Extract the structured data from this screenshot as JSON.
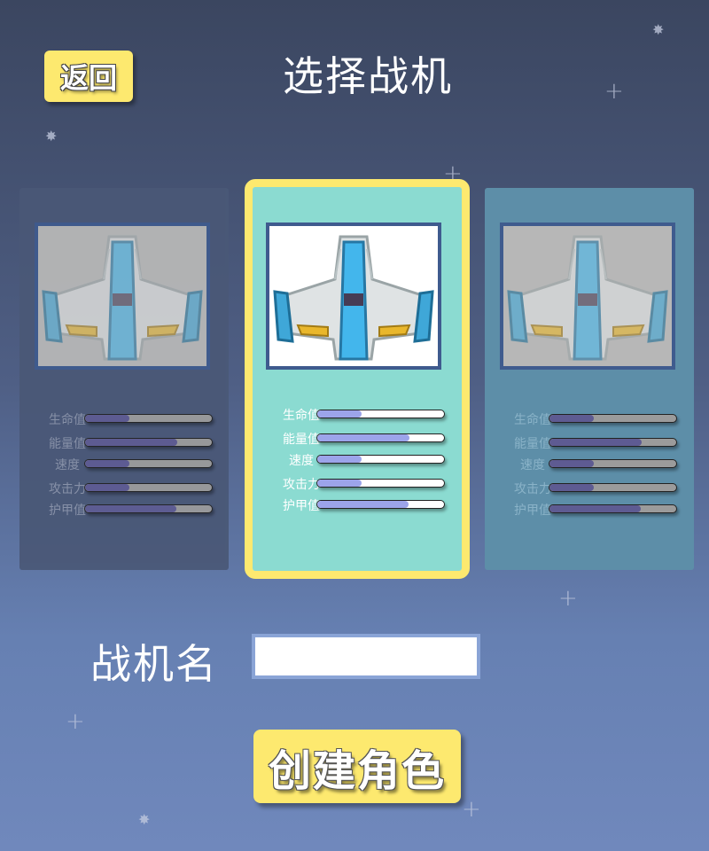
{
  "header": {
    "back_label": "返回",
    "title": "选择战机"
  },
  "stat_labels": [
    "生命值",
    "能量值",
    "速度",
    "攻击力",
    "护甲值"
  ],
  "cards": [
    {
      "id": "left",
      "selected": false,
      "stats": [
        0.35,
        0.73,
        0.35,
        0.35,
        0.72
      ]
    },
    {
      "id": "center",
      "selected": true,
      "stats": [
        0.35,
        0.73,
        0.35,
        0.35,
        0.72
      ]
    },
    {
      "id": "right",
      "selected": false,
      "stats": [
        0.35,
        0.73,
        0.35,
        0.35,
        0.72
      ]
    }
  ],
  "form": {
    "name_label": "战机名",
    "name_value": "",
    "create_label": "创建角色"
  },
  "colors": {
    "accent_yellow": "#fde96f",
    "selected_card": "#8bdbd1",
    "stat_fill": "#9ca4ea"
  }
}
